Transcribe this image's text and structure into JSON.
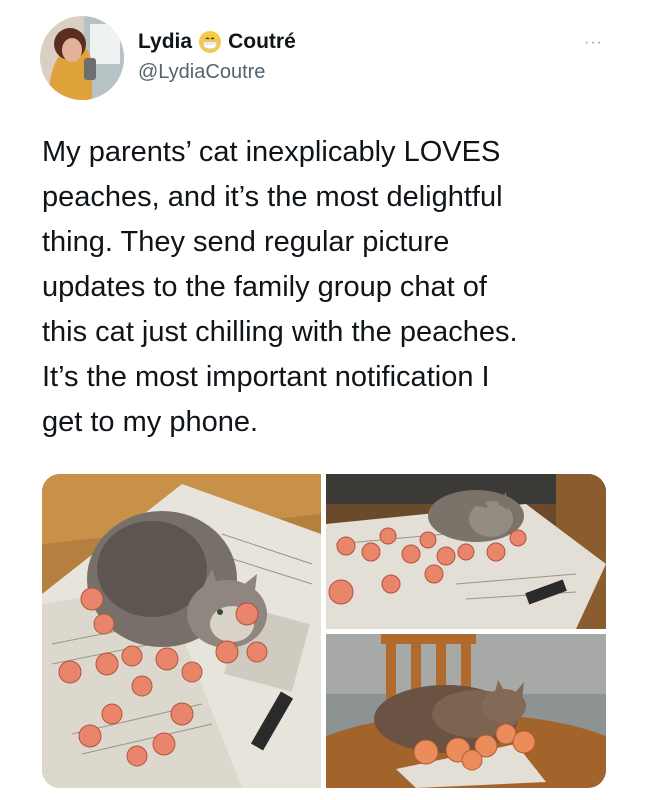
{
  "user": {
    "display_name_first": "Lydia",
    "display_name_last": "Coutré",
    "handle": "@LydiaCoutre",
    "emoji_icon": "face-with-mask-emoji"
  },
  "menu": {
    "more_label": "···"
  },
  "tweet": {
    "text": "My parents’ cat inexplicably LOVES\npeaches, and it’s the most delightful\nthing. They send regular picture\nupdates to the family group chat of\nthis cat just chilling with the peaches.\nIt’s the most important notification I\nget to my phone."
  },
  "media": {
    "photos": [
      {
        "subject": "cat-on-newspaper-with-peaches-overhead"
      },
      {
        "subject": "cat-lying-among-peaches-on-table"
      },
      {
        "subject": "cat-sleeping-by-peaches-on-table"
      }
    ]
  }
}
